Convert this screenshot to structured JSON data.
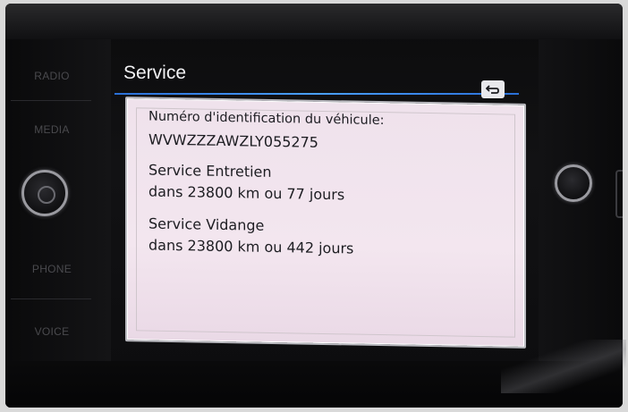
{
  "hardware_buttons": {
    "radio": "RADIO",
    "media": "MEDIA",
    "phone": "PHONE",
    "voice": "VOICE"
  },
  "screen": {
    "title": "Service",
    "back_icon": "back-return-icon",
    "accent_color": "#3a8af0"
  },
  "panel": {
    "vin_label": "Numéro d'identification du véhicule:",
    "vin_value": "WVWZZZAWZLY055275",
    "service_maintenance_label": "Service Entretien",
    "service_maintenance_value": "dans 23800 km ou 77 jours",
    "service_oil_label": "Service Vidange",
    "service_oil_value": "dans 23800 km ou 442 jours"
  }
}
